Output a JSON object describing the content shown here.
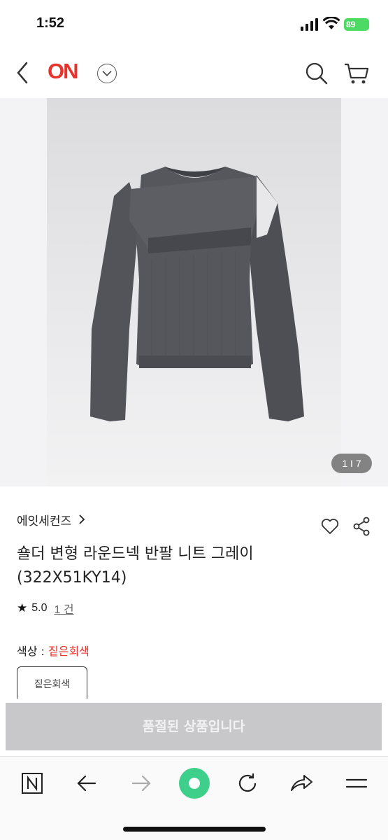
{
  "status_bar": {
    "time": "1:52",
    "battery": "89"
  },
  "header": {
    "logo": "ON",
    "icons": [
      "back-icon",
      "chevron-down-icon",
      "search-icon",
      "cart-icon"
    ]
  },
  "gallery": {
    "counter": "1 I 7"
  },
  "product": {
    "brand": "에잇세컨즈",
    "title": "숄더 변형 라운드넥 반팔 니트 그레이 (322X51KY14)",
    "rating": "5.0",
    "review_count": "1 건",
    "color_label": "색상 : ",
    "color_value": "짙은회색",
    "option_chip": "짙은회색",
    "soldout": "품절된 상품입니다"
  },
  "colors": {
    "accent": "#e8322c",
    "home_button": "#3ed08a",
    "soldout_bg": "#c8c8ca"
  }
}
